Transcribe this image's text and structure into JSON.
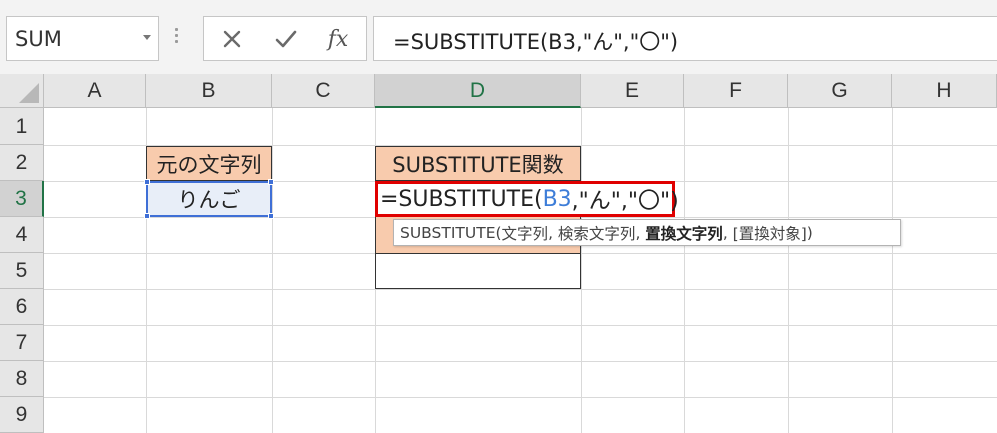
{
  "formula_bar": {
    "name_box": "SUM",
    "fx_label": "fx",
    "formula": "=SUBSTITUTE(B3,\"ん\",\"〇\")"
  },
  "grid": {
    "columns": [
      "A",
      "B",
      "C",
      "D",
      "E",
      "F",
      "G",
      "H"
    ],
    "rows": [
      "1",
      "2",
      "3",
      "4",
      "5",
      "6",
      "7",
      "8",
      "9"
    ],
    "active_column": "D",
    "active_row": "3"
  },
  "cells": {
    "B2": "元の文字列",
    "B3": "りんご",
    "D2": "SUBSTITUTE関数"
  },
  "editor": {
    "prefix": "=SUBSTITUTE(",
    "ref": "B3",
    "suffix": ",\"ん\",\"〇\")"
  },
  "tooltip": {
    "func": "SUBSTITUTE(",
    "arg1": "文字列",
    "sep1": ", ",
    "arg2": "検索文字列",
    "sep2": ", ",
    "arg3": "置換文字列",
    "sep3": ", ",
    "arg4": "[置換対象]",
    "close": ")"
  },
  "colors": {
    "header_fill": "#f8cbad",
    "selection_border": "#3f6fd6",
    "edit_border": "#e00000",
    "active_header_text": "#217346"
  }
}
